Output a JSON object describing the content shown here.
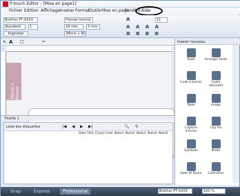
{
  "app": {
    "title": "P-touch Editor - [Mise en page1]"
  },
  "menubar": [
    "Fichier",
    "Edition",
    "Affichage",
    "Insérer",
    "Format",
    "Outils",
    "Mise en page",
    "Fenêtre",
    "Aide"
  ],
  "ribbon": {
    "printer": "Brother PT-XXXX",
    "mode": "Standard",
    "copies": "1",
    "print_label": "Imprimer",
    "format": "Format normal",
    "width": "18 mm",
    "length_value": "3 mm",
    "tape": "38mm x 90m",
    "font": "A",
    "font_size": "11"
  },
  "pages": {
    "tab": "Feuille 1"
  },
  "list": {
    "title": "Liste des étiquettes",
    "columns": [
      "Date",
      "Titre",
      "Corps",
      "Code",
      "Note1",
      "Note2",
      "Note3",
      "Note4",
      "Note5"
    ]
  },
  "right_panel": {
    "title": "Insérer nouveau",
    "tiles": [
      "Texte",
      "Arranger texte",
      "Code à barres",
      "Cadre décoratif",
      "Table",
      "Image",
      "Capture d'écran",
      "Clip Art",
      "Symbole",
      "Photo",
      "Date et heure",
      "Calendrier"
    ]
  },
  "status": {
    "tabs": [
      "Snap",
      "Express",
      "Professional"
    ],
    "printer": "Brother PT-XXXX",
    "zoom": "100 %"
  },
  "canvas": {
    "side_label": "38mm x 90mm"
  }
}
